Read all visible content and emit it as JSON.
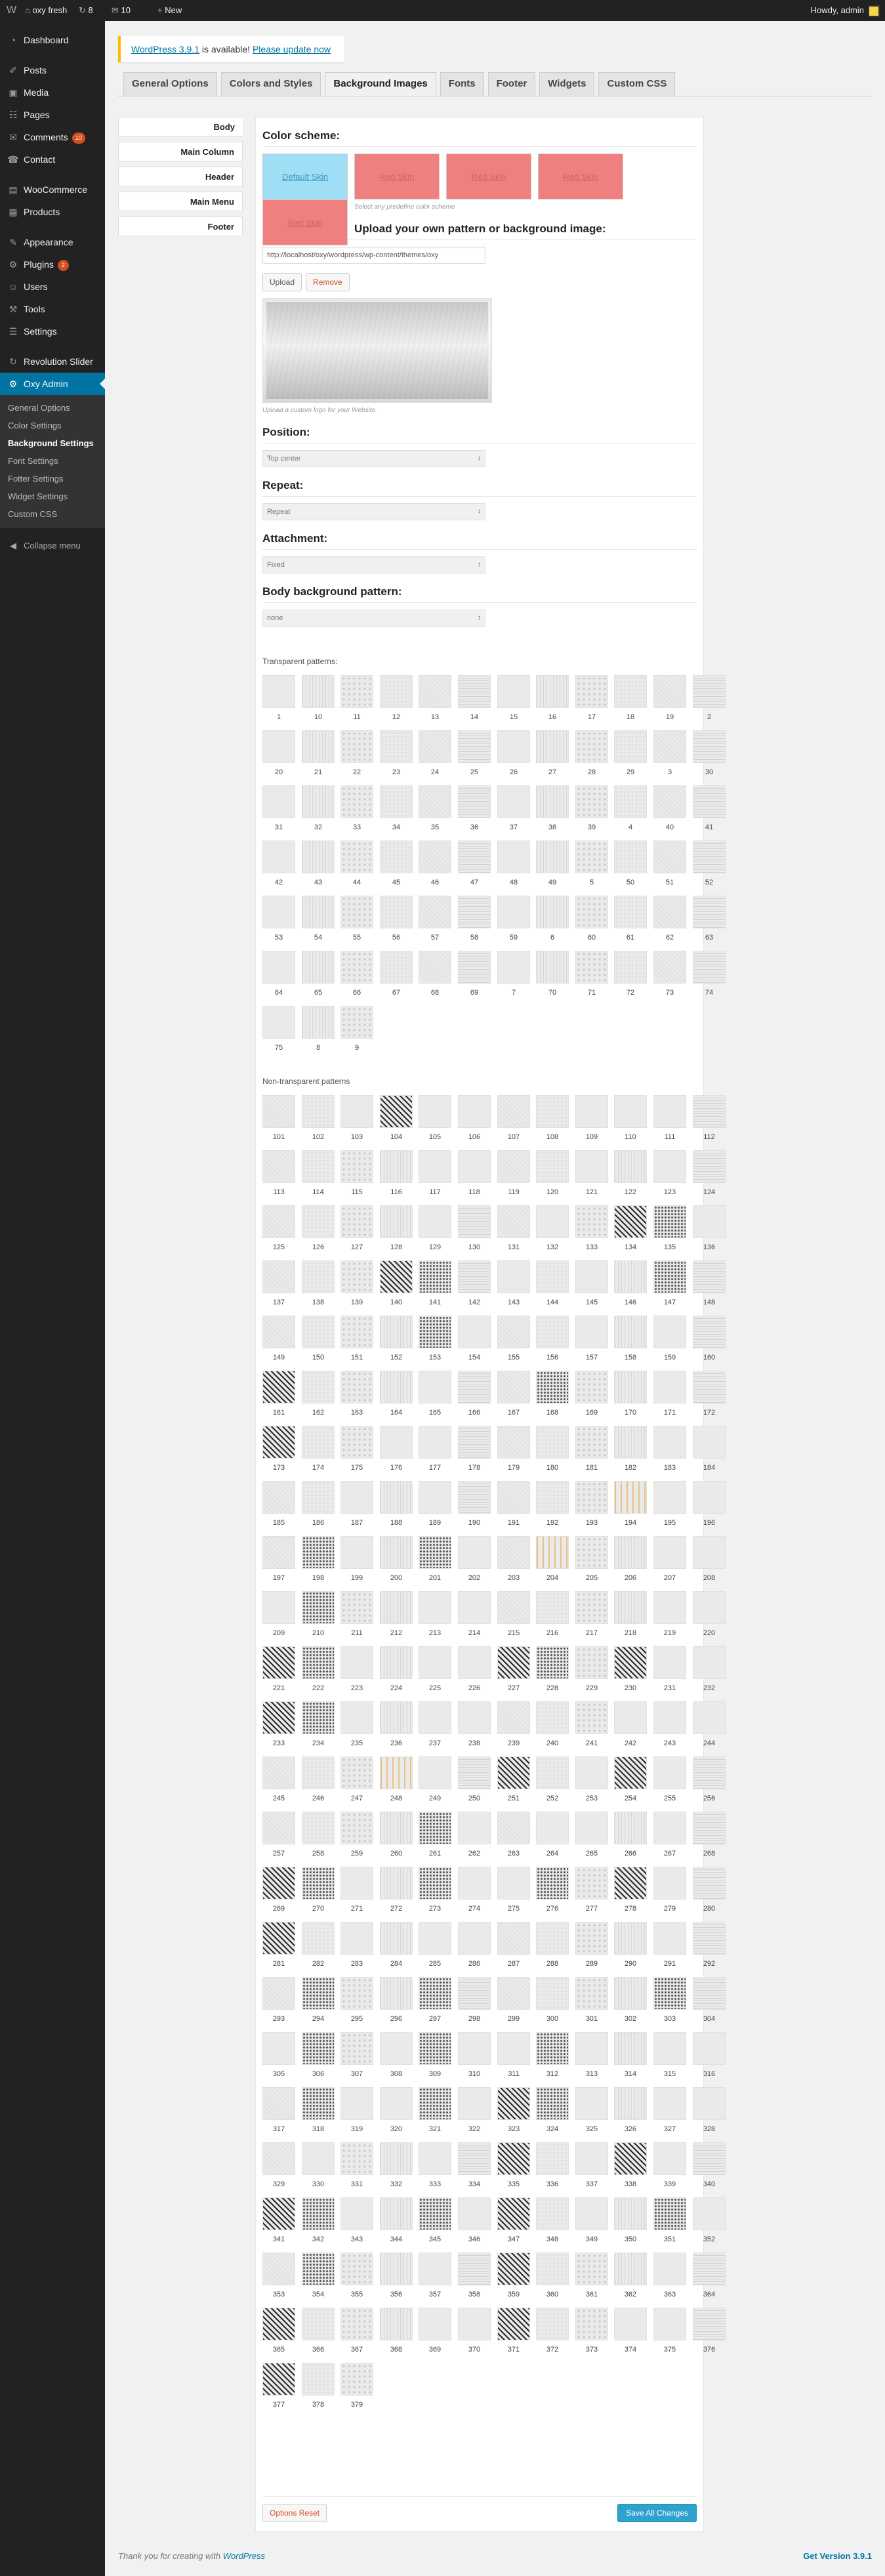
{
  "adminbar": {
    "wp_logo": "W",
    "site_icon": "home-icon",
    "site_name": "oxy fresh",
    "updates_count": "8",
    "comments_count": "10",
    "new_label": "New",
    "howdy": "Howdy, admin"
  },
  "sidebar": {
    "items": [
      {
        "label": "Dashboard",
        "icon": "dashboard-icon",
        "glyph": "◔"
      },
      {
        "label": "Posts",
        "icon": "pin-icon",
        "glyph": "✐"
      },
      {
        "label": "Media",
        "icon": "media-icon",
        "glyph": "▣"
      },
      {
        "label": "Pages",
        "icon": "pages-icon",
        "glyph": "☷"
      },
      {
        "label": "Comments",
        "icon": "comment-icon",
        "glyph": "✉",
        "badge": "10"
      },
      {
        "label": "Contact",
        "icon": "contact-icon",
        "glyph": "☎"
      },
      {
        "label": "WooCommerce",
        "icon": "woocommerce-icon",
        "glyph": "▤"
      },
      {
        "label": "Products",
        "icon": "products-icon",
        "glyph": "▦"
      },
      {
        "label": "Appearance",
        "icon": "brush-icon",
        "glyph": "✎"
      },
      {
        "label": "Plugins",
        "icon": "plugin-icon",
        "glyph": "⚙",
        "badge": "2"
      },
      {
        "label": "Users",
        "icon": "users-icon",
        "glyph": "☺"
      },
      {
        "label": "Tools",
        "icon": "tools-icon",
        "glyph": "⚒"
      },
      {
        "label": "Settings",
        "icon": "settings-icon",
        "glyph": "☰"
      },
      {
        "label": "Revolution Slider",
        "icon": "slider-icon",
        "glyph": "↻"
      },
      {
        "label": "Oxy Admin",
        "icon": "gear-icon",
        "glyph": "⚙"
      }
    ],
    "submenu": [
      "General Options",
      "Color Settings",
      "Background Settings",
      "Font Settings",
      "Fotter Settings",
      "Widget Settings",
      "Custom CSS"
    ],
    "collapse": "Collapse menu"
  },
  "notice": {
    "link": "WordPress 3.9.1",
    "text": " is available! ",
    "update_link": "Please update now"
  },
  "tabs": [
    "General Options",
    "Colors and Styles",
    "Background Images",
    "Fonts",
    "Footer",
    "Widgets",
    "Custom CSS"
  ],
  "left_nav": [
    "Body",
    "Main Column",
    "Header",
    "Main Menu",
    "Footer"
  ],
  "main": {
    "color_scheme_title": "Color scheme:",
    "swatches": [
      "Default Skin",
      "Red Skin",
      "Red Skin",
      "Red Skin",
      "Red Skin"
    ],
    "scheme_note": "Select any predefine color scheme",
    "upload_title": "Upload your own pattern or background image:",
    "url_value": "http://localhost/oxy/wordpress/wp-content/themes/oxy",
    "upload_btn": "Upload",
    "remove_btn": "Remove",
    "logo_note": "Upload a custom logo for your Website.",
    "position_title": "Position:",
    "position_value": "Top center",
    "repeat_title": "Repeat:",
    "repeat_value": "Repeat",
    "attachment_title": "Attachment:",
    "attachment_value": "Fixed",
    "pattern_title": "Body background pattern:",
    "pattern_value": "none",
    "transparent_label": "Transparent patterns:",
    "nontransparent_label": "Non-transparent patterns",
    "reset_btn": "Options Reset",
    "save_btn": "Save All Changes"
  },
  "transparent_patterns": [
    "1",
    "10",
    "11",
    "12",
    "13",
    "14",
    "15",
    "16",
    "17",
    "18",
    "19",
    "2",
    "20",
    "21",
    "22",
    "23",
    "24",
    "25",
    "26",
    "27",
    "28",
    "29",
    "3",
    "30",
    "31",
    "32",
    "33",
    "34",
    "35",
    "36",
    "37",
    "38",
    "39",
    "4",
    "40",
    "41",
    "42",
    "43",
    "44",
    "45",
    "46",
    "47",
    "48",
    "49",
    "5",
    "50",
    "51",
    "52",
    "53",
    "54",
    "55",
    "56",
    "57",
    "58",
    "59",
    "6",
    "60",
    "61",
    "62",
    "63",
    "64",
    "65",
    "66",
    "67",
    "68",
    "69",
    "7",
    "70",
    "71",
    "72",
    "73",
    "74",
    "75",
    "8",
    "9"
  ],
  "nontransparent_start": 101,
  "nontransparent_end": 379,
  "footer": {
    "thanks": "Thank you for creating with ",
    "wp_link": "WordPress",
    "version": "Get Version 3.9.1"
  }
}
